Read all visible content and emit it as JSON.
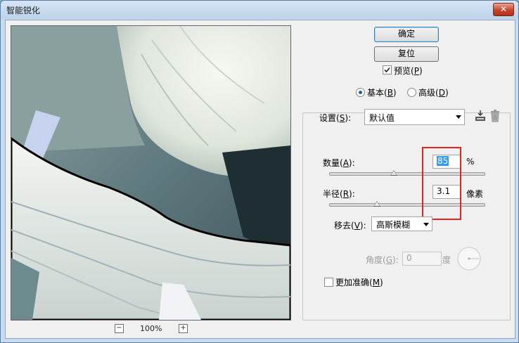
{
  "window": {
    "title": "智能锐化",
    "close_glyph": "✕"
  },
  "preview": {
    "zoom_out": "−",
    "zoom_in": "+",
    "zoom_level": "100%"
  },
  "buttons": {
    "ok": "确定",
    "reset": "复位"
  },
  "preview_toggle": {
    "label_pre": "预览(",
    "key": "P",
    "label_post": ")",
    "checked": true
  },
  "mode": {
    "basic": {
      "label_pre": "基本(",
      "key": "B",
      "label_post": ")",
      "selected": true
    },
    "advanced": {
      "label_pre": "高级(",
      "key": "D",
      "label_post": ")",
      "selected": false
    }
  },
  "settings": {
    "label_pre": "设置(",
    "key": "S",
    "label_post": "):",
    "value": "默认值",
    "save_icon": "save-icon",
    "delete_icon": "trash-icon"
  },
  "amount": {
    "label_pre": "数量(",
    "key": "A",
    "label_post": "):",
    "value": "85",
    "unit": "%",
    "slider_fraction": 0.42
  },
  "radius": {
    "label_pre": "半径(",
    "key": "R",
    "label_post": "):",
    "value": "3.1",
    "unit": "像素",
    "slider_fraction": 0.31
  },
  "remove": {
    "label_pre": "移去(",
    "key": "V",
    "label_post": "):",
    "value": "高斯模糊"
  },
  "angle": {
    "label_pre": "角度(",
    "key": "G",
    "label_post": "):",
    "value": "0",
    "unit": "度"
  },
  "more_accurate": {
    "label_pre": "更加准确(",
    "key": "M",
    "label_post": ")",
    "checked": false
  },
  "colors": {
    "highlight": "#e82220",
    "accent": "#3c7fb1"
  }
}
